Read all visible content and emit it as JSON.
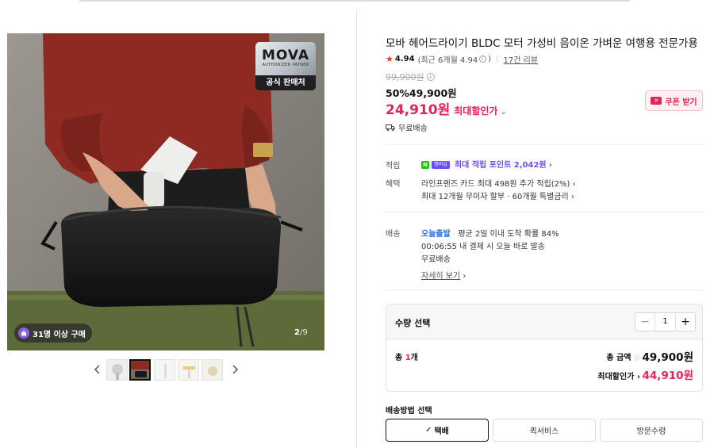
{
  "product": {
    "title": "모바 헤어드라이기 BLDC 모터 가성비 음이온 가벼운 여행용 전문가용",
    "rating": "4.94",
    "rating_detail": "(최근 6개월 4.94",
    "rating_detail_close": ")",
    "review_count": "17건 리뷰",
    "original_price": "99,900원",
    "discount_line": "50%49,900원",
    "best_price": "24,910원",
    "best_price_label": "최대할인가",
    "free_shipping": "무료배송"
  },
  "gallery": {
    "badge_brand": "MOVA",
    "badge_sub": "AUTHORIZED PATNER",
    "badge_official": "공식 판매처",
    "buyers": "31명 이상 구매",
    "counter_current": "2",
    "counter_total": "/9"
  },
  "coupon": {
    "label": "쿠폰 받기"
  },
  "points": {
    "label": "적립",
    "plus_badge": "멤버십",
    "text": "최대 적립 포인트 2,042원"
  },
  "benefits": {
    "label": "혜택",
    "line1": "라인프렌즈 카드 최대 498원 추가 적립(2%)",
    "line2": "최대 12개월 무이자 할부 · 60개월 특별금리"
  },
  "delivery": {
    "label": "배송",
    "today": "오늘출발",
    "arrival": "평균 2일 이내 도착 확률 84%",
    "countdown": "00:06:55  내 결제 시 오늘 바로 발송",
    "fee": "무료배송",
    "more": "자세히 보기"
  },
  "quantity": {
    "title": "수량 선택",
    "value": "1",
    "total_prefix": "총 ",
    "total_count": "1",
    "total_suffix": "개",
    "sum_label": "총 금액",
    "sum_value": "49,900원",
    "best_label": "최대할인가",
    "best_value": "44,910원"
  },
  "shipping_method": {
    "title": "배송방법 선택",
    "options": [
      "택배",
      "퀵서비스",
      "방문수령"
    ],
    "selected": "택배"
  },
  "colors": {
    "accent": "#e0245e",
    "link_blue": "#2a6ee8",
    "naver_green": "#1ec800",
    "point_purple": "#6a4dff"
  }
}
